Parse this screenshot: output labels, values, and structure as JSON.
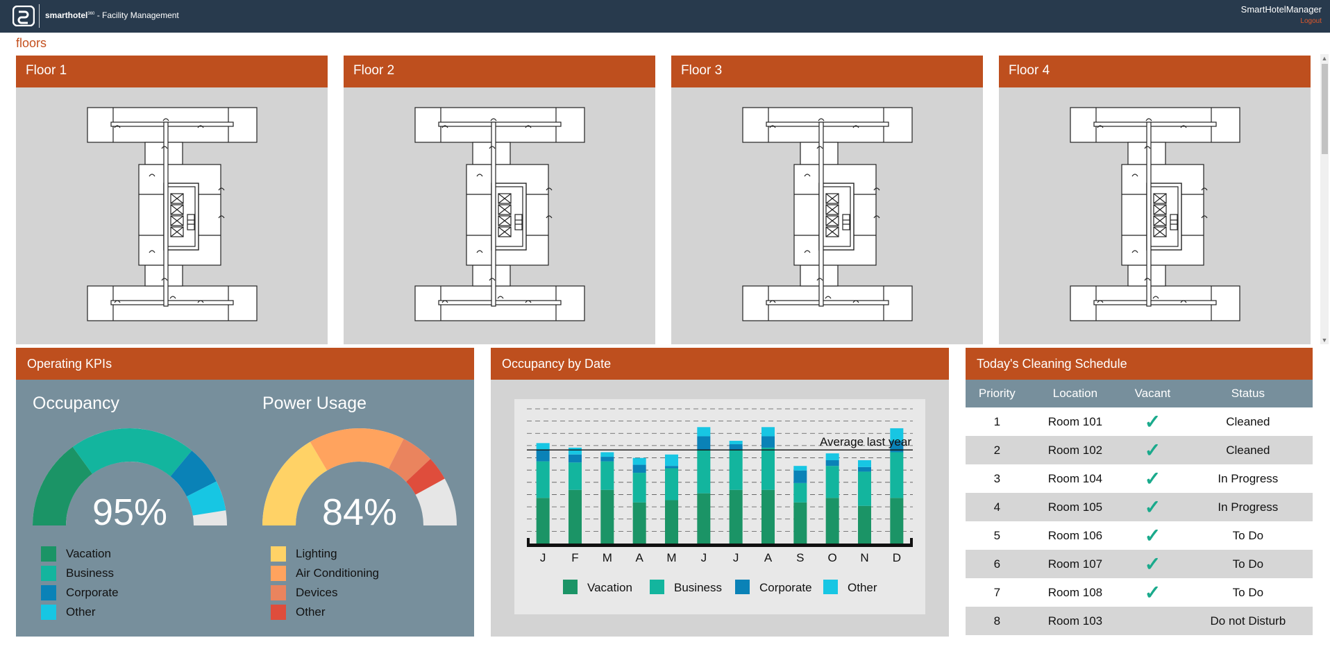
{
  "header": {
    "brand_name": "smarthotel",
    "brand_sup": "360",
    "brand_suffix": "- Facility Management",
    "user_name": "SmartHotelManager",
    "logout_label": "Logout"
  },
  "page_title": "floors",
  "floors": [
    {
      "label": "Floor 1"
    },
    {
      "label": "Floor 2"
    },
    {
      "label": "Floor 3"
    },
    {
      "label": "Floor 4"
    }
  ],
  "kpis": {
    "title": "Operating KPIs",
    "occupancy": {
      "title": "Occupancy",
      "value_label": "95%",
      "value_percent": 95,
      "segments": [
        {
          "name": "Vacation",
          "color": "#1b9466",
          "share": 30
        },
        {
          "name": "Business",
          "color": "#13b59e",
          "share": 42
        },
        {
          "name": "Corporate",
          "color": "#0a82b7",
          "share": 13
        },
        {
          "name": "Other",
          "color": "#17c6e3",
          "share": 10
        }
      ]
    },
    "power": {
      "title": "Power Usage",
      "value_label": "84%",
      "value_percent": 84,
      "segments": [
        {
          "name": "Lighting",
          "color": "#ffd266",
          "share": 33
        },
        {
          "name": "Air Conditioning",
          "color": "#ffa35e",
          "share": 32
        },
        {
          "name": "Devices",
          "color": "#ea845e",
          "share": 11
        },
        {
          "name": "Other",
          "color": "#df4d3c",
          "share": 8
        }
      ]
    }
  },
  "occupancy_chart_title": "Occupancy by Date",
  "chart_data": {
    "type": "bar",
    "stacked": true,
    "categories": [
      "J",
      "F",
      "M",
      "A",
      "M",
      "J",
      "J",
      "A",
      "S",
      "O",
      "N",
      "D"
    ],
    "series": [
      {
        "name": "Vacation",
        "color": "#1b9466",
        "values": [
          40,
          47,
          47,
          36,
          38,
          44,
          47,
          47,
          36,
          40,
          33,
          40
        ]
      },
      {
        "name": "Business",
        "color": "#13b59e",
        "values": [
          32,
          24,
          25,
          26,
          28,
          38,
          35,
          37,
          17,
          28,
          30,
          40
        ]
      },
      {
        "name": "Corporate",
        "color": "#0a82b7",
        "values": [
          10,
          7,
          4,
          7,
          2,
          12,
          5,
          10,
          11,
          5,
          4,
          10
        ]
      },
      {
        "name": "Other",
        "color": "#17c6e3",
        "values": [
          6,
          6,
          4,
          6,
          10,
          8,
          3,
          8,
          4,
          6,
          6,
          11
        ]
      }
    ],
    "ylim": [
      0,
      118
    ],
    "reference_line": {
      "label": "Average last year",
      "value": 82
    },
    "grid": "dashed horizontal",
    "legend_position": "bottom"
  },
  "cleaning": {
    "title": "Today's Cleaning Schedule",
    "columns": [
      "Priority",
      "Location",
      "Vacant",
      "Status"
    ],
    "check_glyph": "✓",
    "rows": [
      {
        "priority": "1",
        "location": "Room 101",
        "vacant": true,
        "status": "Cleaned"
      },
      {
        "priority": "2",
        "location": "Room 102",
        "vacant": true,
        "status": "Cleaned"
      },
      {
        "priority": "3",
        "location": "Room 104",
        "vacant": true,
        "status": "In Progress"
      },
      {
        "priority": "4",
        "location": "Room 105",
        "vacant": true,
        "status": "In Progress"
      },
      {
        "priority": "5",
        "location": "Room 106",
        "vacant": true,
        "status": "To Do"
      },
      {
        "priority": "6",
        "location": "Room 107",
        "vacant": true,
        "status": "To Do"
      },
      {
        "priority": "7",
        "location": "Room 108",
        "vacant": true,
        "status": "To Do"
      },
      {
        "priority": "8",
        "location": "Room 103",
        "vacant": false,
        "status": "Do not Disturb"
      }
    ]
  }
}
